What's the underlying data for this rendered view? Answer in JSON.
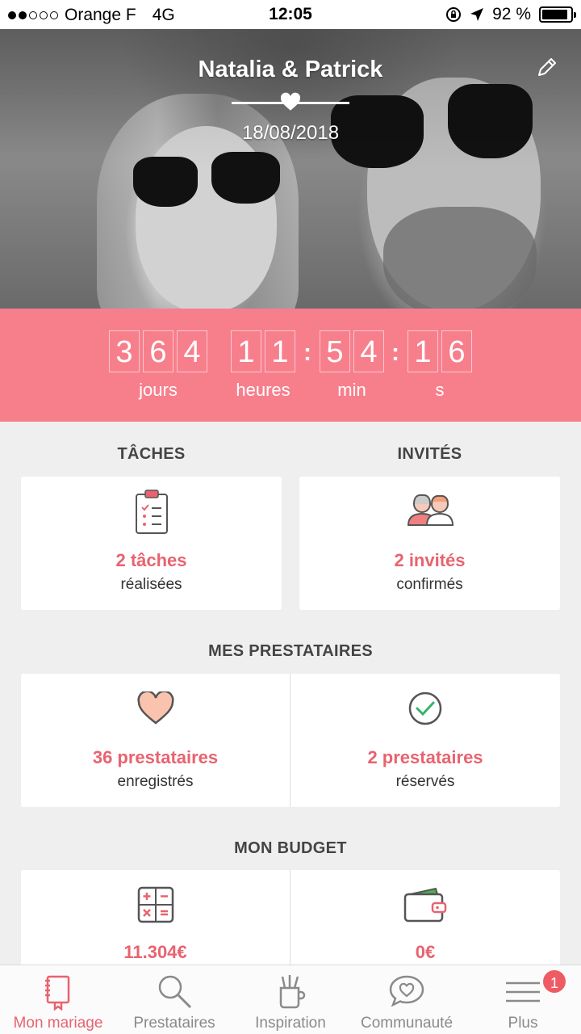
{
  "status_bar": {
    "carrier": "Orange F",
    "network": "4G",
    "time": "12:05",
    "battery": "92 %",
    "battery_level": 0.92
  },
  "hero": {
    "couple_names": "Natalia & Patrick",
    "date": "18/08/2018"
  },
  "countdown": {
    "days": [
      "3",
      "6",
      "4"
    ],
    "hours": [
      "1",
      "1"
    ],
    "minutes": [
      "5",
      "4"
    ],
    "seconds": [
      "1",
      "6"
    ],
    "labels": {
      "days": "jours",
      "hours": "heures",
      "minutes": "min",
      "seconds": "s"
    },
    "color": "#f77f8c"
  },
  "tasks": {
    "title": "TÂCHES",
    "value": "2 tâches",
    "sub": "réalisées"
  },
  "guests": {
    "title": "INVITÉS",
    "value": "2 invités",
    "sub": "confirmés"
  },
  "vendors": {
    "title": "MES PRESTATAIRES",
    "saved_value": "36 prestataires",
    "saved_sub": "enregistrés",
    "booked_value": "2 prestataires",
    "booked_sub": "réservés"
  },
  "budget": {
    "title": "MON BUDGET",
    "estimated": "11.304€",
    "spent": "0€"
  },
  "tabs": [
    {
      "label": "Mon mariage",
      "icon": "notebook-icon",
      "active": true
    },
    {
      "label": "Prestataires",
      "icon": "search-icon"
    },
    {
      "label": "Inspiration",
      "icon": "pencil-cup-icon"
    },
    {
      "label": "Communauté",
      "icon": "chat-heart-icon"
    },
    {
      "label": "Plus",
      "icon": "menu-icon",
      "badge": "1"
    }
  ],
  "accent_color": "#e8636f"
}
